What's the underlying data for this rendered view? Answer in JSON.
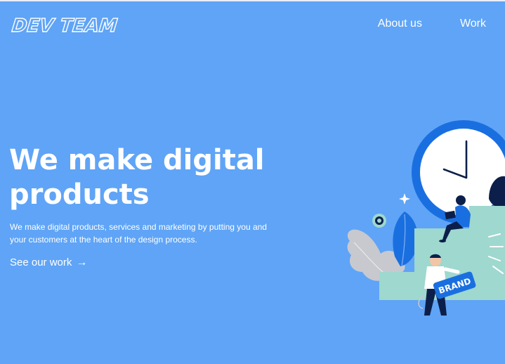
{
  "brand": {
    "logo_text": "DEV TEAM"
  },
  "nav": {
    "items": [
      {
        "label": "About us"
      },
      {
        "label": "Work"
      }
    ]
  },
  "hero": {
    "title": "We make digital products",
    "subtitle": "We make digital products, services and marketing by putting you and your customers at the heart of the design process.",
    "cta_label": "See our work",
    "cta_arrow": "→"
  },
  "illustration": {
    "sign_text": "BRAND"
  },
  "colors": {
    "background": "#5fa4f6",
    "text": "#ffffff",
    "clock_ring": "#1a6fe0",
    "stairs": "#9ed8cf",
    "navy": "#0c1f4a"
  }
}
